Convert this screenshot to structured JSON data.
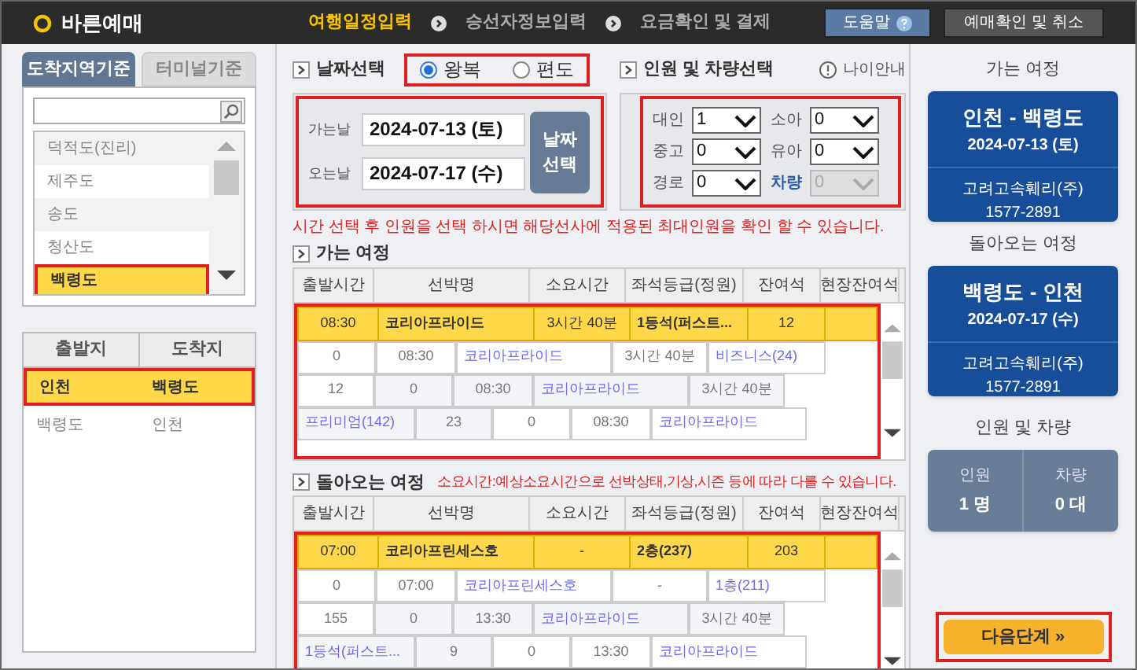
{
  "app_title": "바른예매",
  "steps": [
    {
      "label": "여행일정입력",
      "selected": true
    },
    {
      "label": "승선자정보입력",
      "selected": false
    },
    {
      "label": "요금확인 및 결제",
      "selected": false
    }
  ],
  "header_buttons": [
    {
      "label": "도움말",
      "kind": "help"
    },
    {
      "label": "예매확인 및 취소",
      "kind": "plain"
    }
  ],
  "region_tabs": [
    {
      "label": "도착지역기준",
      "selected": true
    },
    {
      "label": "터미널기준",
      "selected": false
    }
  ],
  "destinations": [
    {
      "label": "덕적도(진리)",
      "selected": false
    },
    {
      "label": "제주도",
      "selected": false
    },
    {
      "label": "송도",
      "selected": false
    },
    {
      "label": "청산도",
      "selected": false
    },
    {
      "label": "백령도",
      "selected": true
    }
  ],
  "routes": {
    "columns": [
      "출발지",
      "도착지"
    ],
    "rows": [
      {
        "cells": [
          "인천",
          "백령도"
        ],
        "selected": true
      },
      {
        "cells": [
          "백령도",
          "인천"
        ],
        "selected": false
      }
    ]
  },
  "date_section": {
    "title": "날짜선택",
    "trip_types": [
      {
        "label": "왕복",
        "selected": true
      },
      {
        "label": "편도",
        "selected": false
      }
    ],
    "fields": [
      {
        "label": "가는날",
        "value": "2024-07-13 (토)"
      },
      {
        "label": "오는날",
        "value": "2024-07-17 (수)"
      }
    ],
    "button": "날짜 선택"
  },
  "passenger_section": {
    "title": "인원 및 차량선택",
    "age_guide": "나이안내",
    "selects": [
      {
        "label": "대인",
        "value": "1",
        "disabled": false,
        "kind": "person"
      },
      {
        "label": "소아",
        "value": "0",
        "disabled": false,
        "kind": "person"
      },
      {
        "label": "중고",
        "value": "0",
        "disabled": false,
        "kind": "person"
      },
      {
        "label": "유아",
        "value": "0",
        "disabled": false,
        "kind": "person"
      },
      {
        "label": "경로",
        "value": "0",
        "disabled": false,
        "kind": "person"
      },
      {
        "label": "차량",
        "value": "0",
        "disabled": true,
        "kind": "vehicle"
      }
    ]
  },
  "notice": "시간 선택 후 인원을 선택 하시면 해당선사에 적용된 최대인원을 확인 할 수 있습니다.",
  "trips": [
    {
      "title": "가는 여정",
      "columns": [
        "출발시간",
        "선박명",
        "소요시간",
        "좌석등급(정원)",
        "잔여석",
        "현장잔여석"
      ],
      "selected_row": [
        "08:30",
        "코리아프라이드",
        "3시간 40분",
        "1등석(퍼스트...",
        "12"
      ],
      "cells": [
        {
          "text": "0",
          "link": false
        },
        {
          "text": "08:30",
          "link": false
        },
        {
          "text": "코리아프라이드",
          "link": true
        },
        {
          "text": "3시간 40분",
          "link": false
        },
        {
          "text": "비즈니스(24)",
          "link": true
        },
        {
          "text": "12",
          "link": false
        },
        {
          "text": "0",
          "link": false
        },
        {
          "text": "08:30",
          "link": false
        },
        {
          "text": "코리아프라이드",
          "link": true
        },
        {
          "text": "3시간 40분",
          "link": false
        },
        {
          "text": "프리미엄(142)",
          "link": true
        },
        {
          "text": "23",
          "link": false
        },
        {
          "text": "0",
          "link": false
        },
        {
          "text": "08:30",
          "link": false
        },
        {
          "text": "코리아프라이드",
          "link": true
        }
      ]
    },
    {
      "title": "돌아오는 여정",
      "note": "소요시간:예상소요시간으로 선박상태,기상,시즌 등에 따라 다를 수 있습니다.",
      "columns": [
        "출발시간",
        "선박명",
        "소요시간",
        "좌석등급(정원)",
        "잔여석",
        "현장잔여석"
      ],
      "selected_row": [
        "07:00",
        "코리아프린세스호",
        "-",
        "2층(237)",
        "203"
      ],
      "cells": [
        {
          "text": "0",
          "link": false
        },
        {
          "text": "07:00",
          "link": false
        },
        {
          "text": "코리아프린세스호",
          "link": true
        },
        {
          "text": "-",
          "link": false
        },
        {
          "text": "1층(211)",
          "link": true
        },
        {
          "text": "155",
          "link": false
        },
        {
          "text": "0",
          "link": false
        },
        {
          "text": "13:30",
          "link": false
        },
        {
          "text": "코리아프라이드",
          "link": true
        },
        {
          "text": "3시간 40분",
          "link": false
        },
        {
          "text": "1등석(퍼스트...",
          "link": true
        },
        {
          "text": "9",
          "link": false
        },
        {
          "text": "0",
          "link": false
        },
        {
          "text": "13:30",
          "link": false
        },
        {
          "text": "코리아프라이드",
          "link": true
        }
      ]
    }
  ],
  "summary": {
    "journeys": [
      {
        "heading": "가는 여정",
        "route": "인천 - 백령도",
        "date": "2024-07-13 (토)",
        "company": "고려고속훼리(주)",
        "phone": "1577-2891"
      },
      {
        "heading": "돌아오는 여정",
        "route": "백령도 - 인천",
        "date": "2024-07-17 (수)",
        "company": "고려고속훼리(주)",
        "phone": "1577-2891"
      }
    ],
    "counts_heading": "인원 및 차량",
    "counts": [
      {
        "label": "인원",
        "value": "1 명"
      },
      {
        "label": "차량",
        "value": "0 대"
      }
    ]
  },
  "next_button": "다음단계 »"
}
